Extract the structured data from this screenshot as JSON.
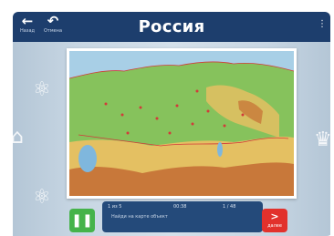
{
  "colors": {
    "header_bg": "#1d3e6d",
    "panel_bg": "#244a7a",
    "play_button": "#45b34a",
    "next_button": "#e2312c",
    "sea": "#a8cfe6",
    "lowland": "#86c25c",
    "upland": "#e4c062",
    "mountain": "#c8783a"
  },
  "header": {
    "back": {
      "icon": "arrow-left-icon",
      "label": "Назад"
    },
    "undo": {
      "icon": "undo-icon",
      "label": "Отмена"
    },
    "title": "Россия",
    "menu_icon": "settings-icon"
  },
  "map": {
    "icon": "russia-physical-map",
    "description_free": true
  },
  "controls": {
    "play": {
      "icon": "play-icon"
    },
    "next": {
      "icon": "chevron-right-icon",
      "label": "далее"
    }
  },
  "info_panel": {
    "left_text": "1 из 5",
    "mid_text": "00:38",
    "right_text": "1 / 48",
    "hint": "Найди на карте объект"
  }
}
